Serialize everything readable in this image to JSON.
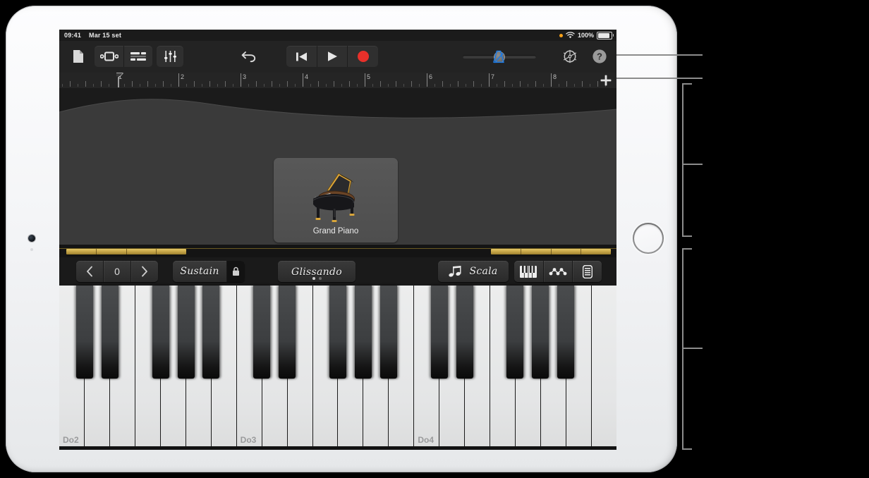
{
  "status_bar": {
    "time": "09:41",
    "date": "Mar 15 set",
    "battery_percent": "100%",
    "recording_dot": "orange-dot",
    "wifi": "wifi-icon",
    "battery": "battery-icon"
  },
  "toolbar": {
    "navigation_icon": "document-icon",
    "track_view_icon": "track-view-icon",
    "mixer_icon": "mixer-icon",
    "settings_sliders_icon": "sliders-icon",
    "undo_icon": "undo-icon",
    "rewind_icon": "rewind-icon",
    "play_icon": "play-icon",
    "record_icon": "record-icon",
    "volume_slider_value": 50,
    "metronome_icon": "metronome-icon",
    "metronome_color": "#1f7ae0",
    "settings_icon": "gear-icon",
    "help_icon": "help-icon"
  },
  "ruler": {
    "bars": [
      "1",
      "2",
      "3",
      "4",
      "5",
      "6",
      "7",
      "8"
    ],
    "playhead_bar": "1",
    "add_section_icon": "plus-icon"
  },
  "instrument": {
    "name": "Grand Piano",
    "artwork": "grand-piano-icon"
  },
  "controls": {
    "octave_down": "chevron-left-icon",
    "octave_value": "0",
    "octave_up": "chevron-right-icon",
    "sustain_label": "Sustain",
    "sustain_lock_icon": "lock-icon",
    "glissando_label": "Glissando",
    "glissando_page_dots": 2,
    "glissando_active_dot": 0,
    "scala_label": "Scala",
    "scala_notes_icon": "eighth-notes-icon",
    "keyboard_layout_icon": "keyboard-icon",
    "chords_icon": "chord-dots-icon",
    "notes_strip_icon": "note-strip-icon"
  },
  "keyboard": {
    "white_key_count": 22,
    "labels": [
      {
        "index": 0,
        "text": "Do2"
      },
      {
        "index": 7,
        "text": "Do3"
      },
      {
        "index": 14,
        "text": "Do4"
      }
    ],
    "black_key_pattern": [
      0,
      1,
      3,
      4,
      5
    ]
  },
  "colors": {
    "accent_blue": "#1f7ae0",
    "record_red": "#e8302a",
    "gold": "#c9a84a",
    "screen_bg": "#1c1c1c",
    "callout_gray": "#8c8c8c"
  }
}
